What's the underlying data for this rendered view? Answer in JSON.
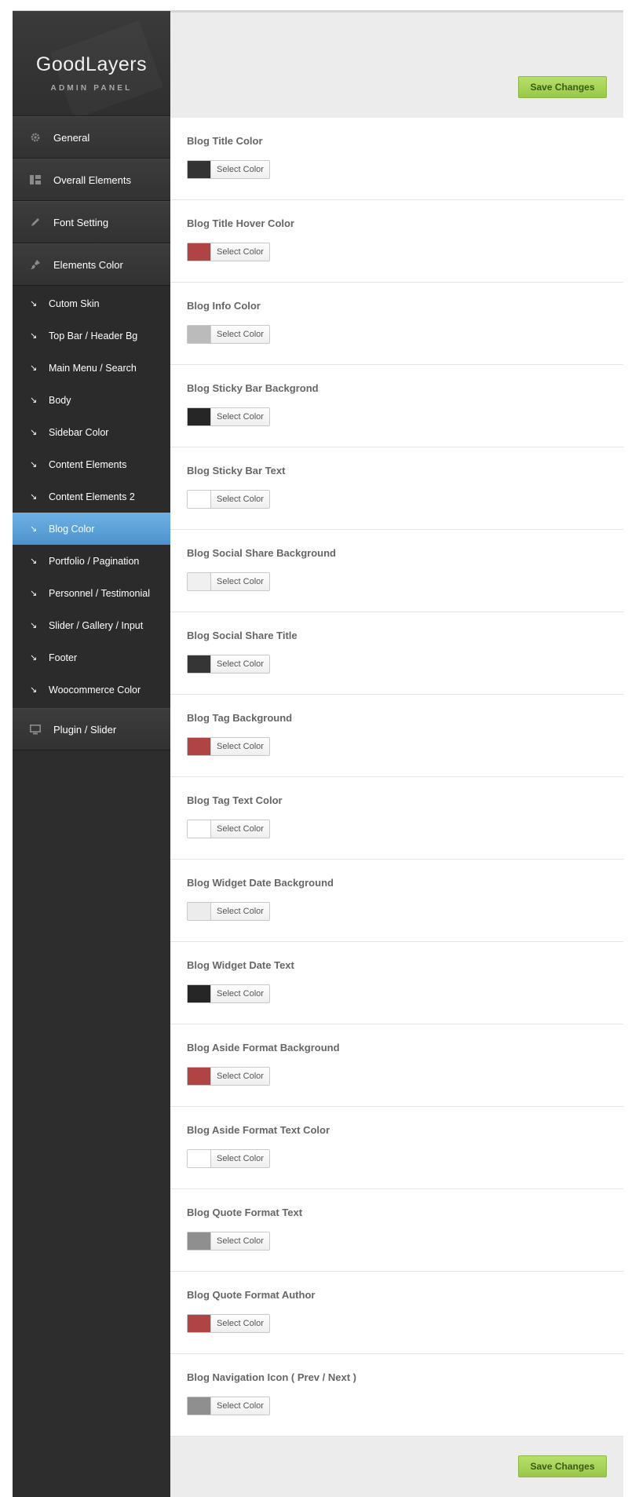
{
  "brand": {
    "title": "GoodLayers",
    "subtitle": "ADMIN PANEL"
  },
  "sidebar": {
    "main_top": [
      {
        "label": "General",
        "icon": "gear-icon"
      },
      {
        "label": "Overall Elements",
        "icon": "layout-icon"
      },
      {
        "label": "Font Setting",
        "icon": "pencil-icon"
      },
      {
        "label": "Elements Color",
        "icon": "brush-icon"
      }
    ],
    "sub_items": [
      {
        "label": "Cutom Skin"
      },
      {
        "label": "Top Bar / Header Bg"
      },
      {
        "label": "Main Menu / Search"
      },
      {
        "label": "Body"
      },
      {
        "label": "Sidebar Color"
      },
      {
        "label": "Content Elements"
      },
      {
        "label": "Content Elements 2"
      },
      {
        "label": "Blog Color",
        "active": true
      },
      {
        "label": "Portfolio / Pagination"
      },
      {
        "label": "Personnel / Testimonial"
      },
      {
        "label": "Slider / Gallery / Input"
      },
      {
        "label": "Footer"
      },
      {
        "label": "Woocommerce Color"
      }
    ],
    "main_bottom": [
      {
        "label": "Plugin / Slider",
        "icon": "monitor-icon"
      }
    ]
  },
  "toolbar": {
    "save_label": "Save Changes"
  },
  "select_color_label": "Select Color",
  "options": [
    {
      "label": "Blog Title Color",
      "color": "#333333"
    },
    {
      "label": "Blog Title Hover Color",
      "color": "#b04444"
    },
    {
      "label": "Blog Info Color",
      "color": "#bbbbbb"
    },
    {
      "label": "Blog Sticky Bar Backgrond",
      "color": "#262626"
    },
    {
      "label": "Blog Sticky Bar Text",
      "color": "#ffffff"
    },
    {
      "label": "Blog Social Share Background",
      "color": "#f0f0f0"
    },
    {
      "label": "Blog Social Share Title",
      "color": "#353535"
    },
    {
      "label": "Blog Tag Background",
      "color": "#b04444"
    },
    {
      "label": "Blog Tag Text Color",
      "color": "#ffffff"
    },
    {
      "label": "Blog Widget Date Background",
      "color": "#ececec"
    },
    {
      "label": "Blog Widget Date Text",
      "color": "#262626"
    },
    {
      "label": "Blog Aside Format Background",
      "color": "#b04444"
    },
    {
      "label": "Blog Aside Format Text Color",
      "color": "#ffffff"
    },
    {
      "label": "Blog Quote Format Text",
      "color": "#8f8f8f"
    },
    {
      "label": "Blog Quote Format Author",
      "color": "#b04444"
    },
    {
      "label": "Blog Navigation Icon ( Prev / Next )",
      "color": "#8f8f8f"
    }
  ]
}
